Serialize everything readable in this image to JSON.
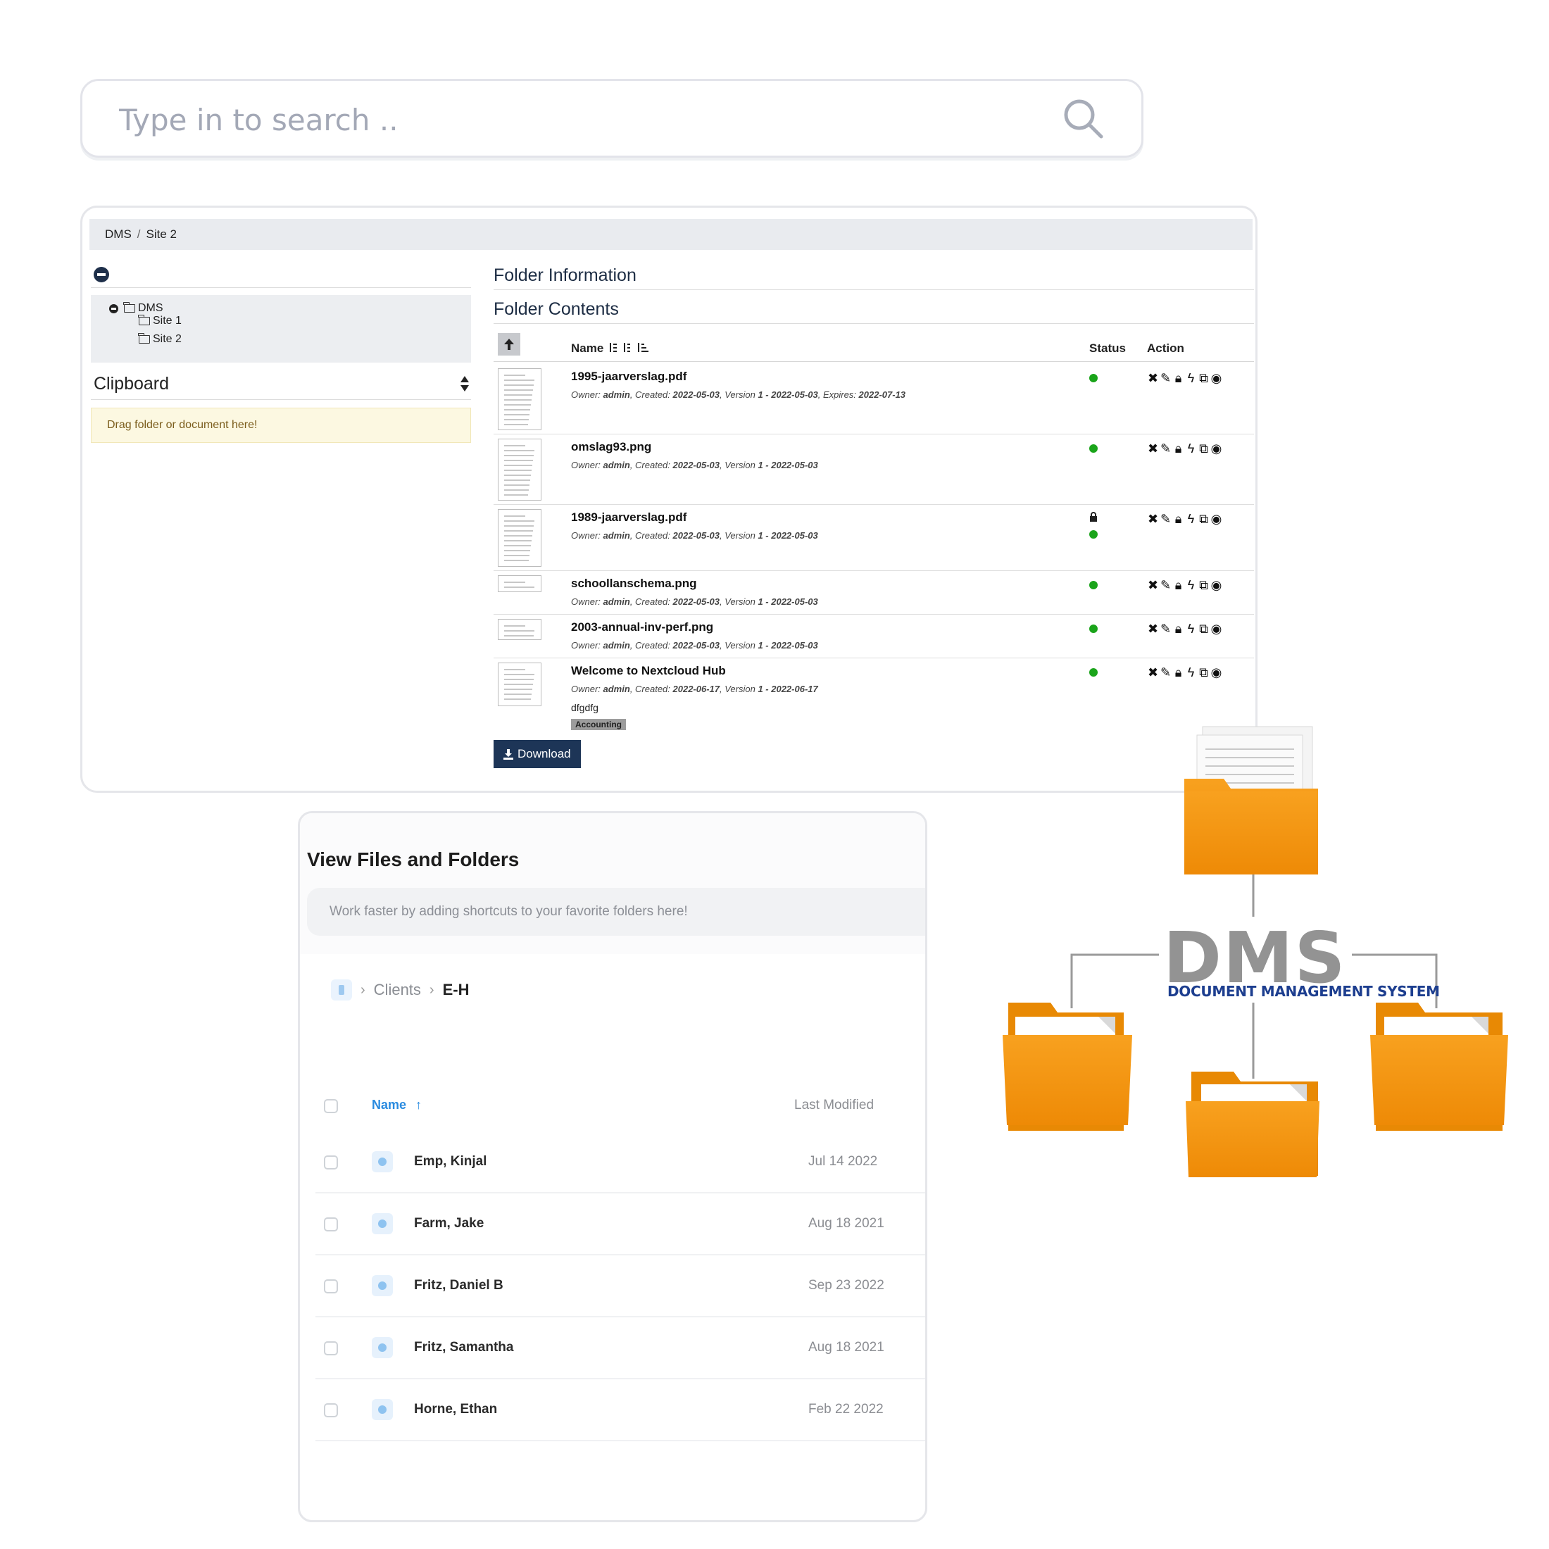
{
  "search": {
    "placeholder": "Type in to search .."
  },
  "dms_window": {
    "breadcrumb": [
      "DMS",
      "Site 2"
    ],
    "breadcrumb_sep": "/",
    "tree": {
      "root": "DMS",
      "children": [
        "Site 1",
        "Site 2"
      ]
    },
    "clipboard": {
      "title": "Clipboard",
      "drop_text": "Drag folder or document here!"
    },
    "folder_information": "Folder Information",
    "folder_contents": "Folder Contents",
    "columns": {
      "name": "Name",
      "status": "Status",
      "action": "Action"
    },
    "meta_labels": {
      "owner": "Owner:",
      "created": "Created:",
      "version": "Version",
      "expires": "Expires:"
    },
    "rows": [
      {
        "name": "1995-jaarverslag.pdf",
        "owner": "admin",
        "created": "2022-05-03",
        "version": "1",
        "version_date": "2022-05-03",
        "expires": "2022-07-13",
        "locked": false
      },
      {
        "name": "omslag93.png",
        "owner": "admin",
        "created": "2022-05-03",
        "version": "1",
        "version_date": "2022-05-03",
        "locked": false
      },
      {
        "name": "1989-jaarverslag.pdf",
        "owner": "admin",
        "created": "2022-05-03",
        "version": "1",
        "version_date": "2022-05-03",
        "locked": true
      },
      {
        "name": "schoollanschema.png",
        "owner": "admin",
        "created": "2022-05-03",
        "version": "1",
        "version_date": "2022-05-03",
        "locked": false
      },
      {
        "name": "2003-annual-inv-perf.png",
        "owner": "admin",
        "created": "2022-05-03",
        "version": "1",
        "version_date": "2022-05-03",
        "locked": false
      },
      {
        "name": "Welcome to Nextcloud Hub",
        "owner": "admin",
        "created": "2022-06-17",
        "version": "1",
        "version_date": "2022-06-17",
        "comment": "dfgdfg",
        "tag": "Accounting",
        "locked": false
      }
    ],
    "download_label": "Download",
    "status_color": "#1aa41a"
  },
  "files_window": {
    "title": "View Files and Folders",
    "shortcut_hint": "Work faster by adding shortcuts to your favorite folders here!",
    "breadcrumb": [
      "Clients",
      "E-H"
    ],
    "columns": {
      "name": "Name",
      "sort_arrow": "↑",
      "modified": "Last Modified"
    },
    "rows": [
      {
        "name": "Emp, Kinjal",
        "modified": "Jul 14 2022"
      },
      {
        "name": "Farm, Jake",
        "modified": "Aug 18 2021"
      },
      {
        "name": "Fritz, Daniel B",
        "modified": "Sep 23 2022"
      },
      {
        "name": "Fritz, Samantha",
        "modified": "Aug 18 2021"
      },
      {
        "name": "Horne, Ethan",
        "modified": "Feb 22 2022"
      }
    ]
  },
  "diagram": {
    "logo": "DMS",
    "subtitle": "DOCUMENT MANAGEMENT SYSTEM",
    "folder_color": "#f2960f"
  }
}
